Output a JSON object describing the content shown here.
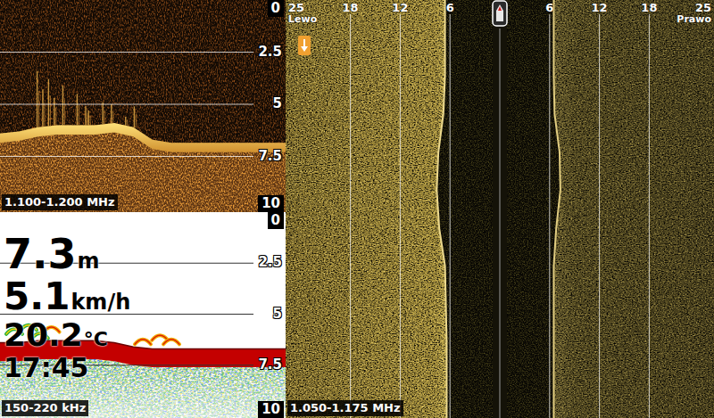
{
  "down_imaging": {
    "frequency": "1.100-1.200 MHz",
    "depth_ticks": [
      {
        "label": "0",
        "depth": 0
      },
      {
        "label": "2.5",
        "depth": 2.5
      },
      {
        "label": "5",
        "depth": 5
      },
      {
        "label": "7.5",
        "depth": 7.5
      },
      {
        "label": "10",
        "depth": 10
      }
    ],
    "bottom_profile_m": [
      6.4,
      6.3,
      6.1,
      6.0,
      6.0,
      6.0,
      5.9,
      6.1,
      6.7,
      6.85,
      6.85,
      6.85,
      6.85,
      6.85,
      6.85,
      6.85
    ],
    "vegetation": [
      {
        "ping": 13,
        "top_m": 3.4
      },
      {
        "ping": 15,
        "top_m": 4.3
      },
      {
        "ping": 17,
        "top_m": 3.8
      },
      {
        "ping": 19,
        "top_m": 4.7
      },
      {
        "ping": 22,
        "top_m": 4.1
      },
      {
        "ping": 27,
        "top_m": 4.5
      },
      {
        "ping": 30,
        "top_m": 5.1
      },
      {
        "ping": 31,
        "top_m": 5.3
      },
      {
        "ping": 36,
        "top_m": 4.9
      },
      {
        "ping": 39,
        "top_m": 5.0
      },
      {
        "ping": 44,
        "top_m": 5.6
      },
      {
        "ping": 47,
        "top_m": 5.1
      }
    ]
  },
  "sonar_2d": {
    "frequency": "150-220 kHz",
    "depth_ticks": [
      {
        "label": "0",
        "depth": 0
      },
      {
        "label": "2.5",
        "depth": 2.5
      },
      {
        "label": "5",
        "depth": 5
      },
      {
        "label": "7.5",
        "depth": 7.5
      },
      {
        "label": "10",
        "depth": 10
      }
    ],
    "bottom_profile_m": [
      6.4,
      6.4,
      6.3,
      6.3,
      6.3,
      6.3,
      6.4,
      6.6,
      6.7,
      6.7,
      6.7,
      6.7,
      6.7,
      6.7,
      6.7,
      6.7
    ],
    "fish_arcs": [
      {
        "ping": 5,
        "depth": 5.8,
        "strength": 0.7
      },
      {
        "ping": 10,
        "depth": 5.6,
        "strength": 0.8
      },
      {
        "ping": 14,
        "depth": 6.0,
        "strength": 0.6
      },
      {
        "ping": 18,
        "depth": 5.7,
        "strength": 0.5
      },
      {
        "ping": 50,
        "depth": 6.3,
        "strength": 0.4
      },
      {
        "ping": 56,
        "depth": 6.1,
        "strength": 0.5
      },
      {
        "ping": 60,
        "depth": 6.3,
        "strength": 0.3
      }
    ]
  },
  "readouts": [
    {
      "value": "7.3",
      "unit": "m"
    },
    {
      "value": "5.1",
      "unit": "km/h"
    },
    {
      "value": "20.2",
      "unit": "°C"
    },
    {
      "value": "17:45"
    }
  ],
  "side_imaging": {
    "frequency": "1.050-1.175 MHz",
    "range_m": 25,
    "range_ticks": [
      {
        "label": "25",
        "side": "left",
        "m": 25
      },
      {
        "label": "18",
        "side": "left",
        "m": 18
      },
      {
        "label": "12",
        "side": "left",
        "m": 12
      },
      {
        "label": "6",
        "side": "left",
        "m": 6
      },
      {
        "label": "6",
        "side": "right",
        "m": 6
      },
      {
        "label": "12",
        "side": "right",
        "m": 12
      },
      {
        "label": "18",
        "side": "right",
        "m": 18
      },
      {
        "label": "25",
        "side": "right",
        "m": 25
      }
    ],
    "side_labels": [
      {
        "label": "Lewo",
        "side": "left"
      },
      {
        "label": "Prawo",
        "side": "right"
      }
    ],
    "left_bottom_m": [
      6.6,
      6.6,
      6.6,
      6.8,
      7.4,
      7.6,
      7.3,
      6.6,
      6.5,
      6.4,
      6.4,
      6.4
    ],
    "right_bottom_m": [
      6.5,
      6.5,
      6.5,
      6.6,
      7.2,
      7.3,
      6.8,
      6.5,
      6.5,
      6.5,
      6.5,
      6.5
    ]
  }
}
